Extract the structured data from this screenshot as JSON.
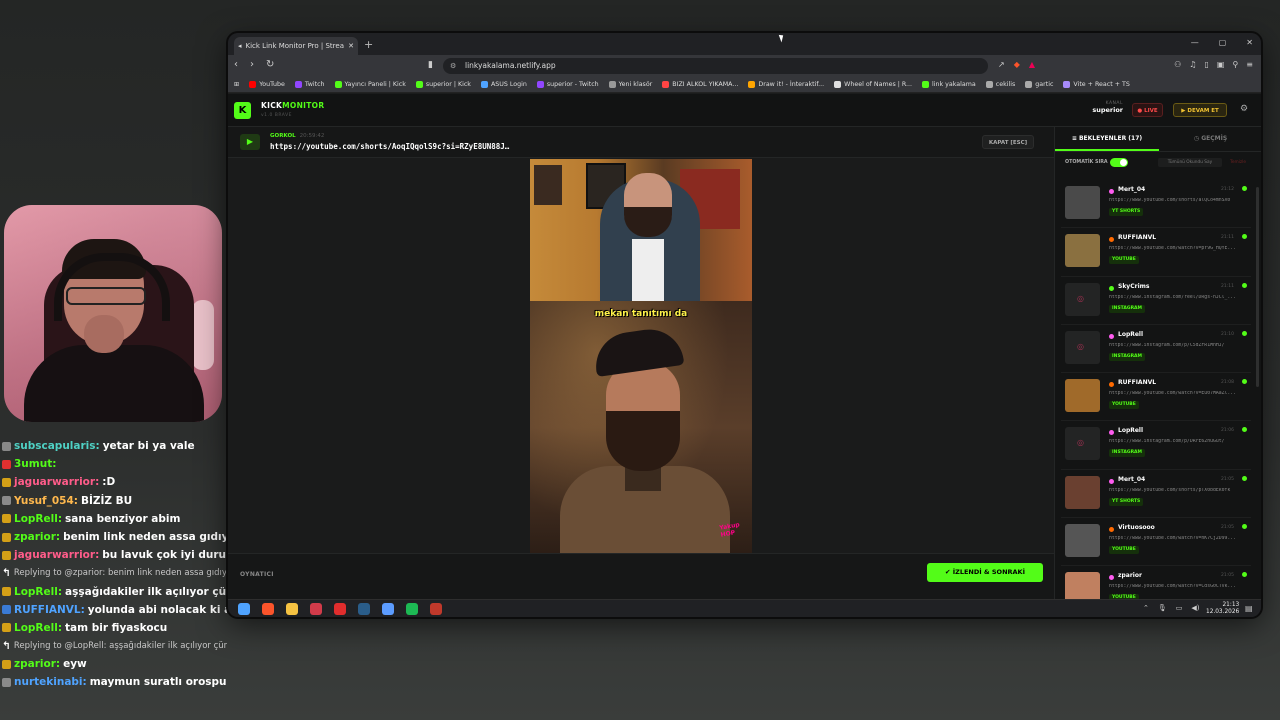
{
  "chat": {
    "messages": [
      {
        "user": "subscapularis:",
        "text": "yetar bi ya vale",
        "color": "#4fd1c5",
        "badge": "#888"
      },
      {
        "user": "3umut:",
        "text": "",
        "color": "#53fc18",
        "badge": "#e03030"
      },
      {
        "user": "jaguarwarrior:",
        "text": ":D",
        "color": "#ff5c8a",
        "badge": "#d4a017"
      },
      {
        "user": "Yusuf_054:",
        "text": "BİZİZ BU",
        "color": "#ffb84d",
        "badge": "#8a8a8a"
      },
      {
        "user": "LopRell:",
        "text": "sana benziyor abim",
        "color": "#53fc18",
        "badge": "#d4a017"
      },
      {
        "user": "zparior:",
        "text": "benim link neden assa gıdıyo",
        "color": "#53fc18",
        "badge": "#d4a017"
      },
      {
        "user": "jaguarwarrior:",
        "text": "bu lavuk çok iyi duruyo",
        "color": "#ff5c8a",
        "badge": "#d4a017"
      },
      {
        "reply": "Replying to @zparior: benim link neden assa gıdıyo"
      },
      {
        "user": "LopRell:",
        "text": "aşşağıdakiler ilk açılıyor çünkü",
        "color": "#53fc18",
        "badge": "#d4a017"
      },
      {
        "user": "RUFFIANVL:",
        "text": "yolunda abi nolacak ki amk",
        "color": "#4fa3ff",
        "badge": "#3a7bd5"
      },
      {
        "user": "LopRell:",
        "text": "tam bir fiyaskocu",
        "color": "#53fc18",
        "badge": "#d4a017"
      },
      {
        "reply": "Replying to @LopRell: aşşağıdakiler ilk açılıyor çünkü"
      },
      {
        "user": "zparior:",
        "text": "eyw",
        "color": "#53fc18",
        "badge": "#d4a017"
      },
      {
        "user": "nurtekinabi:",
        "text": "maymun suratlı orospu cocugu",
        "color": "#4fa3ff",
        "badge": "#8a8a8a"
      }
    ]
  },
  "browser": {
    "tab_title": "Kick Link Monitor Pro | Stream",
    "url": "linkyakalama.netlify.app",
    "bookmarks": [
      {
        "label": "YouTube",
        "color": "#ff0000"
      },
      {
        "label": "Twitch",
        "color": "#9146ff"
      },
      {
        "label": "Yayıncı Paneli | Kick",
        "color": "#53fc18"
      },
      {
        "label": "superior | Kick",
        "color": "#53fc18"
      },
      {
        "label": "ASUS Login",
        "color": "#4fa3ff"
      },
      {
        "label": "superior - Twitch",
        "color": "#9146ff"
      },
      {
        "label": "Yeni klasör",
        "color": "#999"
      },
      {
        "label": "BIZI ALKOL YIKAMA...",
        "color": "#ff4444"
      },
      {
        "label": "Draw it! - İnteraktif...",
        "color": "#ffa500"
      },
      {
        "label": "Wheel of Names | R...",
        "color": "#e0e0e0"
      },
      {
        "label": "link yakalama",
        "color": "#53fc18"
      },
      {
        "label": "cekilis",
        "color": "#aaa"
      },
      {
        "label": "gartic",
        "color": "#aaa"
      },
      {
        "label": "Vite + React + TS",
        "color": "#a78bfa"
      }
    ]
  },
  "app": {
    "logo": "K",
    "brand_main": "KICK",
    "brand_accent": "MONITOR",
    "version": "v1.0 BRAVE",
    "kanal_label": "KANAL",
    "kanal_value": "superior",
    "live_label": "LIVE",
    "devam_label": "DEVAM ET",
    "current": {
      "sender": "GORKOL",
      "time": "20:59:42",
      "url": "https://youtube.com/shorts/AoqIQqolS9c?si=RZyE8UN88J…"
    },
    "kapat_label": "KAPAT [ESC]",
    "caption": "mekan tanıtımı da",
    "watermark": "Yakup HOP",
    "player_label": "OYNATICI",
    "next_label": "İZLENDİ & SONRAKİ",
    "accent": "#53fc18"
  },
  "sidebar": {
    "tab_waiting": "BEKLEYENLER (17)",
    "tab_history": "GEÇMİŞ",
    "auto_label": "OTOMATİK SIRA",
    "auto_on": true,
    "mark_all": "Tümünü Okundu Say",
    "clear": "Temizle",
    "items": [
      {
        "name": "Mert_04",
        "time": "21:12",
        "url": "https://www.youtube.com/shorts/alQCo4mnSX0",
        "tag": "YT SHORTS",
        "dot": "#ff5cf0",
        "thumb": "#4a4a4a"
      },
      {
        "name": "RUFFIANVL",
        "time": "21:11",
        "url": "https://www.youtube.com/watch?v=pY9G_HQYE...",
        "tag": "YOUTUBE",
        "dot": "#ff6a00",
        "thumb": "#8a7040"
      },
      {
        "name": "SkyCrims",
        "time": "21:11",
        "url": "https://www.instagram.com/reel/DRgs-nJCl_...",
        "tag": "INSTAGRAM",
        "dot": "#53fc18",
        "thumb": ""
      },
      {
        "name": "LopRell",
        "time": "21:10",
        "url": "https://www.instagram.com/p/C5dZFR1MnHJ/",
        "tag": "INSTAGRAM",
        "dot": "#ff5cf0",
        "thumb": ""
      },
      {
        "name": "RUFFIANVL",
        "time": "21:08",
        "url": "https://www.youtube.com/watch?v=Eu07MAaZl...",
        "tag": "YOUTUBE",
        "dot": "#ff6a00",
        "thumb": "#a06a2a"
      },
      {
        "name": "LopRell",
        "time": "21:06",
        "url": "https://www.instagram.com/p/DRrE62huGut/",
        "tag": "INSTAGRAM",
        "dot": "#ff5cf0",
        "thumb": ""
      },
      {
        "name": "Mert_04",
        "time": "21:05",
        "url": "https://www.youtube.com/shorts/pTX0bdEk0fk",
        "tag": "YT SHORTS",
        "dot": "#ff5cf0",
        "thumb": "#6a4030"
      },
      {
        "name": "Virtuosooo",
        "time": "21:05",
        "url": "https://www.youtube.com/watch?v=nK7Cj2D99...",
        "tag": "YOUTUBE",
        "dot": "#ff6a00",
        "thumb": "#555"
      },
      {
        "name": "zparior",
        "time": "21:05",
        "url": "https://www.youtube.com/watch?v=CdsG0CTvk...",
        "tag": "YOUTUBE",
        "dot": "#ff5cf0",
        "thumb": "#c08060"
      }
    ]
  },
  "taskbar": {
    "time": "21:13",
    "date": "12.03.2026",
    "apps": [
      {
        "name": "windows-icon",
        "color": "#4fa3ff"
      },
      {
        "name": "brave-icon",
        "color": "#fb542b"
      },
      {
        "name": "folder-icon",
        "color": "#f5c242"
      },
      {
        "name": "pin-icon",
        "color": "#d23b4a"
      },
      {
        "name": "record-icon",
        "color": "#e02d2d"
      },
      {
        "name": "steam-icon",
        "color": "#2a5d8a"
      },
      {
        "name": "chrome-icon",
        "color": "#5c9cff"
      },
      {
        "name": "spotify-icon",
        "color": "#1db954"
      },
      {
        "name": "app-icon",
        "color": "#c0392b"
      }
    ]
  }
}
